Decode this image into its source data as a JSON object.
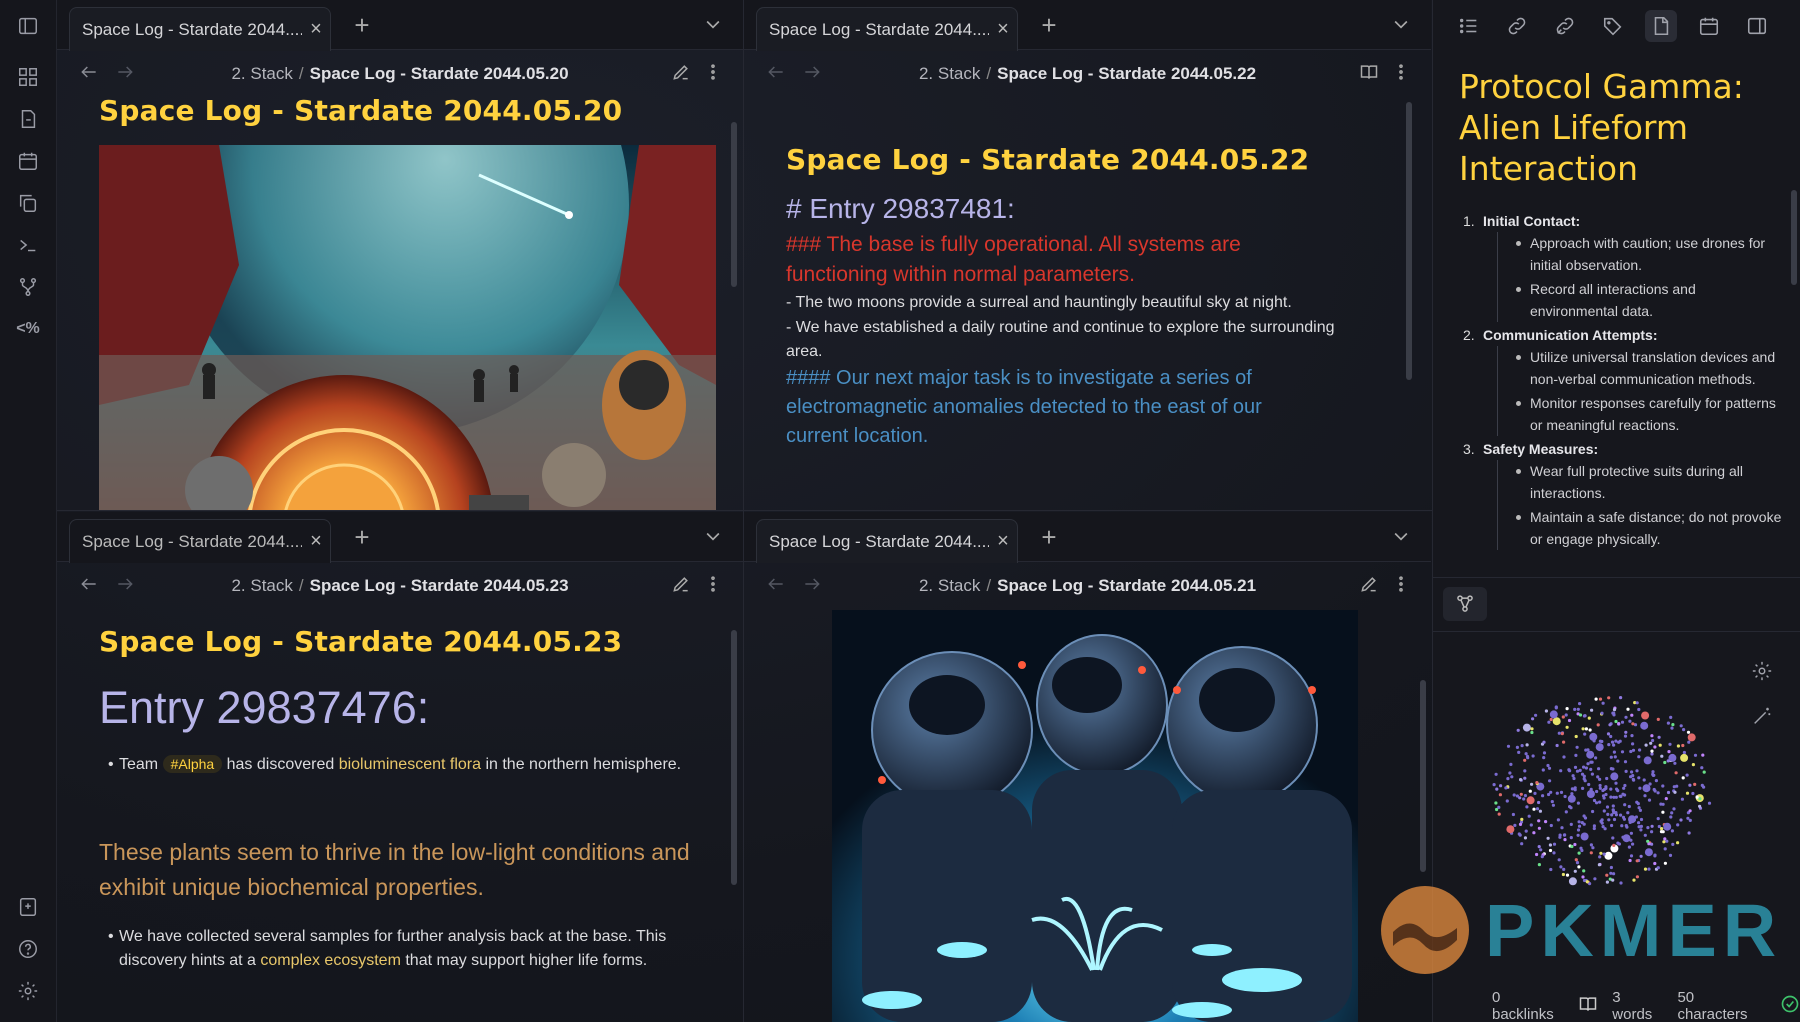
{
  "panes": {
    "top_left": {
      "tab_title": "Space Log - Stardate 2044....",
      "breadcrumb_folder": "2. Stack",
      "breadcrumb_note": "Space Log - Stardate 2044.05.20",
      "heading": "Space Log - Stardate 2044.05.20"
    },
    "top_right": {
      "tab_title": "Space Log - Stardate 2044....",
      "breadcrumb_folder": "2. Stack",
      "breadcrumb_note": "Space Log - Stardate 2044.05.22",
      "heading": "Space Log - Stardate 2044.05.22",
      "entry": "# Entry 29837481:",
      "h3": "### The base is fully operational. All systems are functioning within normal parameters.",
      "line1": "- The two moons provide a surreal and hauntingly beautiful sky at night.",
      "line2": "- We have established a daily routine and continue to explore the surrounding area.",
      "h4": "#### Our next major task is to investigate a series of electromagnetic anomalies detected to the east of our current location."
    },
    "bottom_left": {
      "tab_title": "Space Log - Stardate 2044....",
      "breadcrumb_folder": "2. Stack",
      "breadcrumb_note": "Space Log - Stardate 2044.05.23",
      "heading": "Space Log - Stardate 2044.05.23",
      "entry": "Entry 29837476:",
      "b1_pre": "Team",
      "b1_tag": "#Alpha",
      "b1_mid": "has discovered",
      "b1_link": "bioluminescent flora",
      "b1_post": "in the northern hemisphere.",
      "h2": "These plants seem to thrive in the low-light conditions and exhibit unique biochemical properties.",
      "b2_pre": "We have collected several samples for further analysis back at the base. This discovery hints at a",
      "b2_link": "complex ecosystem",
      "b2_post": "that may support higher life forms."
    },
    "bottom_right": {
      "tab_title": "Space Log - Stardate 2044....",
      "breadcrumb_folder": "2. Stack",
      "breadcrumb_note": "Space Log - Stardate 2044.05.21"
    }
  },
  "right_panel": {
    "title": "Protocol Gamma: Alien Lifeform Interaction",
    "sections": [
      {
        "num": "1.",
        "label": "Initial Contact:",
        "items": [
          "Approach with caution; use drones for initial observation.",
          "Record all interactions and environmental data."
        ]
      },
      {
        "num": "2.",
        "label": "Communication Attempts:",
        "items": [
          "Utilize universal translation devices and non-verbal communication methods.",
          "Monitor responses carefully for patterns or meaningful reactions."
        ]
      },
      {
        "num": "3.",
        "label": "Safety Measures:",
        "items": [
          "Wear full protective suits during all interactions.",
          "Maintain a safe distance; do not provoke or engage physically."
        ]
      }
    ],
    "watermark": "PKMER"
  },
  "statusbar": {
    "backlinks": "0 backlinks",
    "words": "3 words",
    "characters": "50 characters"
  },
  "colors": {
    "heading": "#ffd23f",
    "h3_red": "#d8362c",
    "h4_blue": "#4a8fc4",
    "entry_lavender": "#b7b4e8",
    "h2_orange": "#c9965a"
  }
}
